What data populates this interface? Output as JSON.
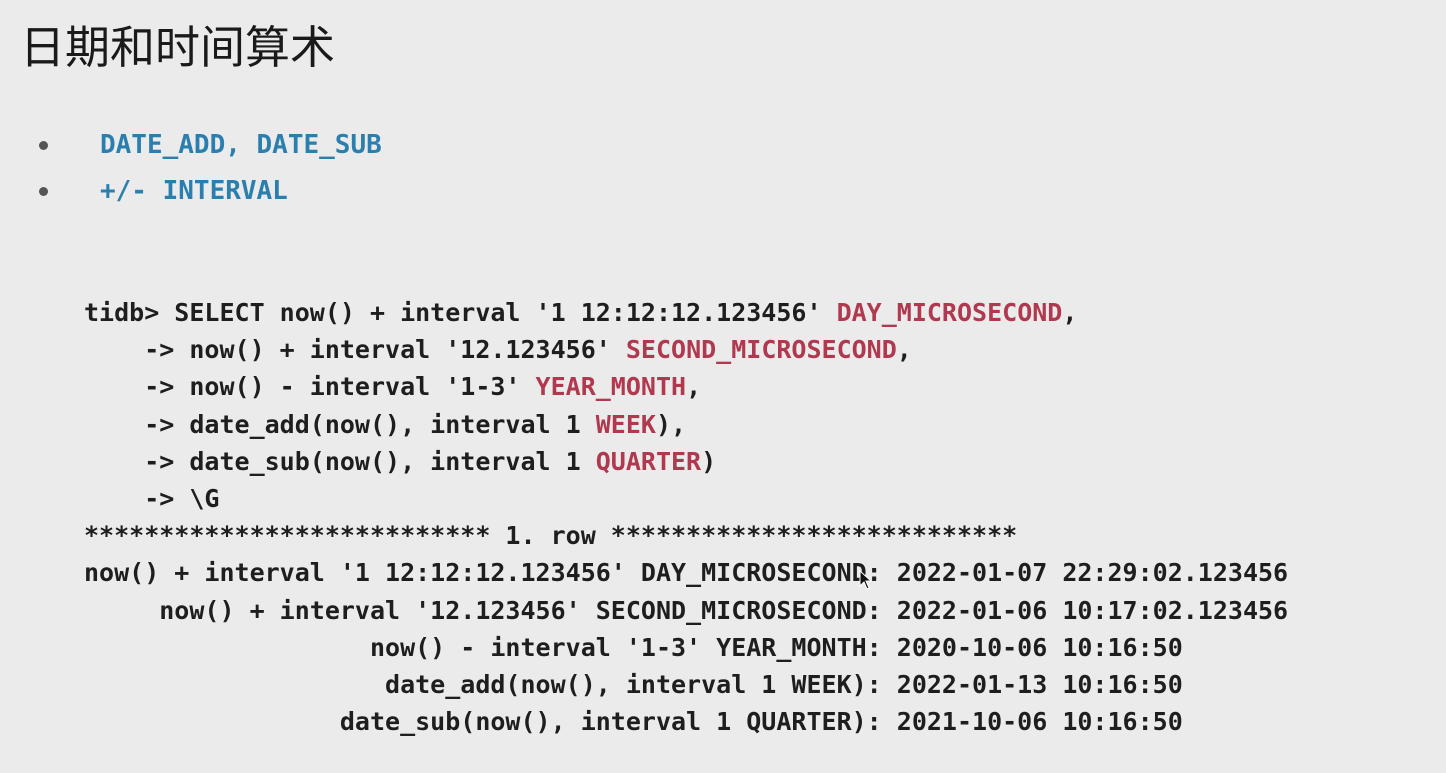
{
  "title": "日期和时间算术",
  "bullets": [
    "DATE_ADD, DATE_SUB",
    "+/- INTERVAL"
  ],
  "code": {
    "query": [
      {
        "pre": "tidb> SELECT now() + interval '1 12:12:12.123456' ",
        "kw": "DAY_MICROSECOND",
        "post": ","
      },
      {
        "pre": "    -> now() + interval '12.123456' ",
        "kw": "SECOND_MICROSECOND",
        "post": ","
      },
      {
        "pre": "    -> now() - interval '1-3' ",
        "kw": "YEAR_MONTH",
        "post": ","
      },
      {
        "pre": "    -> date_add(now(), interval 1 ",
        "kw": "WEEK",
        "post": "),"
      },
      {
        "pre": "    -> date_sub(now(), interval 1 ",
        "kw": "QUARTER",
        "post": ")"
      },
      {
        "pre": "    -> \\G",
        "kw": "",
        "post": ""
      }
    ],
    "row_header": "*************************** 1. row ***************************",
    "results": [
      "now() + interval '1 12:12:12.123456' DAY_MICROSECOND: 2022-01-07 22:29:02.123456",
      "     now() + interval '12.123456' SECOND_MICROSECOND: 2022-01-06 10:17:02.123456",
      "                   now() - interval '1-3' YEAR_MONTH: 2020-10-06 10:16:50",
      "                    date_add(now(), interval 1 WEEK): 2022-01-13 10:16:50",
      "                 date_sub(now(), interval 1 QUARTER): 2021-10-06 10:16:50"
    ]
  },
  "colors": {
    "background": "#ebebeb",
    "bullet_text": "#2b7fae",
    "keyword": "#b0394f",
    "code_text": "#1e1e1e"
  },
  "icons": [
    "bullet-dot",
    "mouse-pointer-icon"
  ]
}
